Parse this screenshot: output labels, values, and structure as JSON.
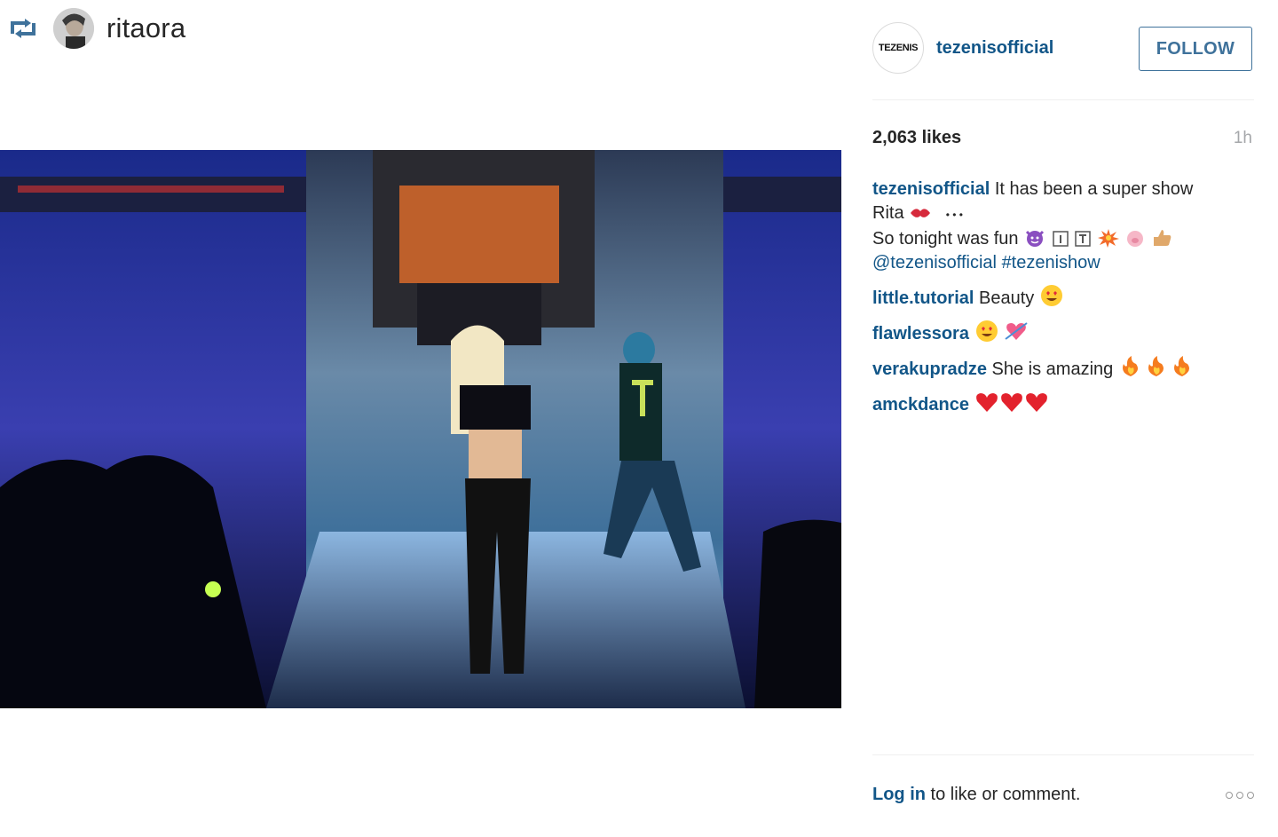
{
  "repost": {
    "icon": "repost-icon",
    "username": "ritaora"
  },
  "post": {
    "image": "concert-stage-photo",
    "author": {
      "logo_text": "TEZENIS",
      "username": "tezenisofficial"
    },
    "follow_label": "FOLLOW",
    "likes": "2,063 likes",
    "time_ago": "1h",
    "caption": {
      "username": "tezenisofficial",
      "line1": "It has been a super show",
      "line2": "Rita",
      "line2_dots": "• • •",
      "line3": "So tonight was fun",
      "mention": "@tezenisofficial",
      "hashtag": "#tezenishow"
    },
    "comments": [
      {
        "username": "little.tutorial",
        "text": "Beauty"
      },
      {
        "username": "flawlessora",
        "text": ""
      },
      {
        "username": "verakupradze",
        "text": "She is amazing"
      },
      {
        "username": "amckdance",
        "text": ""
      }
    ],
    "footer": {
      "login_link": "Log in",
      "login_rest": "to like or comment."
    }
  },
  "colors": {
    "link": "#125688",
    "follow": "#3f729b",
    "muted": "#a5a7aa"
  }
}
